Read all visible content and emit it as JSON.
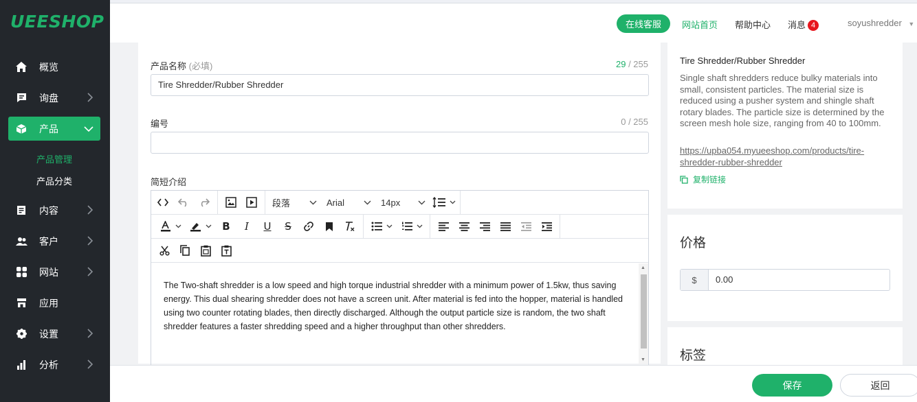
{
  "app": {
    "logo": "UEESHOP"
  },
  "sidebar": {
    "items": [
      {
        "label": "概览",
        "icon": "home-icon"
      },
      {
        "label": "询盘",
        "icon": "inquiry-icon"
      },
      {
        "label": "产品",
        "icon": "product-box-icon"
      },
      {
        "label": "内容",
        "icon": "content-icon"
      },
      {
        "label": "客户",
        "icon": "customers-icon"
      },
      {
        "label": "网站",
        "icon": "website-icon"
      },
      {
        "label": "应用",
        "icon": "store-icon"
      },
      {
        "label": "设置",
        "icon": "gear-icon"
      },
      {
        "label": "分析",
        "icon": "bar-chart-icon"
      }
    ],
    "product_sub": [
      {
        "label": "产品管理",
        "active": true
      },
      {
        "label": "产品分类",
        "active": false
      }
    ],
    "active_color": "#1fb16a"
  },
  "header": {
    "service": "在线客服",
    "home": "网站首页",
    "help": "帮助中心",
    "messages": "消息",
    "messages_count": "4",
    "user": "soyushredder"
  },
  "form": {
    "name_label": "产品名称",
    "name_required": "(必填)",
    "name_count_current": "29",
    "name_count_max": " / 255",
    "name_value": "Tire Shredder/Rubber Shredder",
    "code_label": "编号",
    "code_count": "0 / 255",
    "code_value": "",
    "brief_label": "简短介绍"
  },
  "editor": {
    "paragraph_select": "段落",
    "font_select": "Arial",
    "size_select": "14px",
    "content": "The Two-shaft shredder is a low speed and high torque industrial shredder with a minimum power of 1.5kw, thus saving energy. This dual shearing shredder does not have a screen unit. After material is fed into the hopper, material is handled using two counter rotating blades, then directly discharged. Although the output particle size is random, the two shaft shredder features a faster shredding speed and a higher throughput than other shredders."
  },
  "seo": {
    "title": "Tire Shredder/Rubber Shredder",
    "description": "Single shaft shredders reduce bulky materials into small, consistent particles. The material size is reduced using a pusher system and shingle shaft rotary blades. The particle size is determined by the screen mesh hole size, ranging from 40 to 100mm.",
    "url": "https://upba054.myueeshop.com/products/tire-shredder-rubber-shredder",
    "copy_link": "复制链接"
  },
  "price": {
    "title": "价格",
    "currency": "$",
    "value": "0.00"
  },
  "tags": {
    "title": "标签"
  },
  "footer": {
    "save": "保存",
    "back": "返回"
  }
}
